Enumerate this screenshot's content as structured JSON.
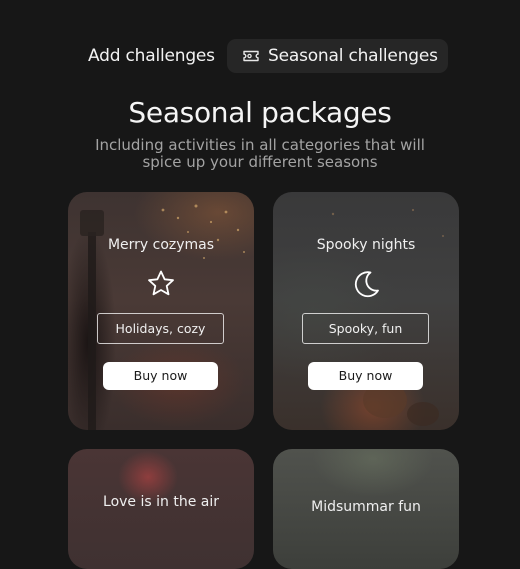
{
  "tabs": {
    "add_label": "Add challenges",
    "seasonal_label": "Seasonal challenges",
    "seasonal_icon": "ticket-icon",
    "active": "Seasonal challenges"
  },
  "header": {
    "title": "Seasonal packages",
    "subtitle": "Including activities in all categories that will spice up your different seasons"
  },
  "packages": [
    {
      "title": "Merry cozymas",
      "icon": "star-icon",
      "tags": "Holidays, cozy",
      "button": "Buy now"
    },
    {
      "title": "Spooky nights",
      "icon": "moon-icon",
      "tags": "Spooky, fun",
      "button": "Buy now"
    },
    {
      "title": "Love is in the air"
    },
    {
      "title": "Midsummar fun"
    }
  ],
  "colors": {
    "background": "#171717",
    "tab_active_bg": "#262626",
    "subtitle": "#a3a3a3",
    "button_bg": "#ffffff"
  }
}
